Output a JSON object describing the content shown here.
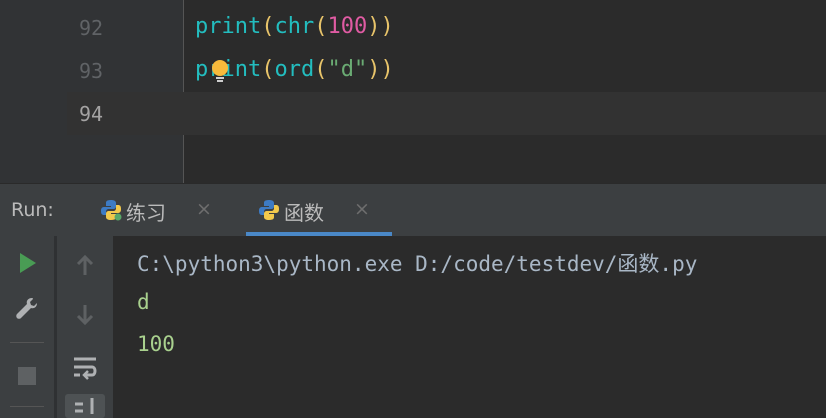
{
  "editor": {
    "lines": [
      {
        "number": "92",
        "tokens": [
          {
            "text": "print",
            "cls": "fn"
          },
          {
            "text": "(",
            "cls": "paren"
          },
          {
            "text": "chr",
            "cls": "fn"
          },
          {
            "text": "(",
            "cls": "paren"
          },
          {
            "text": "100",
            "cls": "num"
          },
          {
            "text": "))",
            "cls": "paren"
          }
        ]
      },
      {
        "number": "93",
        "tokens": [
          {
            "text": "print",
            "cls": "fn"
          },
          {
            "text": "(",
            "cls": "paren"
          },
          {
            "text": "ord",
            "cls": "fn"
          },
          {
            "text": "(",
            "cls": "paren"
          },
          {
            "text": "\"d\"",
            "cls": "str"
          },
          {
            "text": "))",
            "cls": "paren"
          }
        ]
      },
      {
        "number": "94",
        "tokens": []
      }
    ]
  },
  "run": {
    "label": "Run:",
    "tabs": [
      {
        "label": "练习",
        "close": "×"
      },
      {
        "label": "函数",
        "close": "×"
      }
    ]
  },
  "console": {
    "command": "C:\\python3\\python.exe D:/code/testdev/函数.py",
    "output": [
      "d",
      "100"
    ]
  },
  "colors": {
    "run_green": "#499c54",
    "tab_active_underline": "#4a88c7",
    "bulb": "#f6b93b"
  },
  "icons": [
    "run-icon",
    "settings-wrench-icon",
    "stop-icon",
    "scroll-up-icon",
    "scroll-down-icon",
    "soft-wrap-icon",
    "scroll-to-end-icon",
    "python-file-icon",
    "intention-bulb-icon"
  ]
}
